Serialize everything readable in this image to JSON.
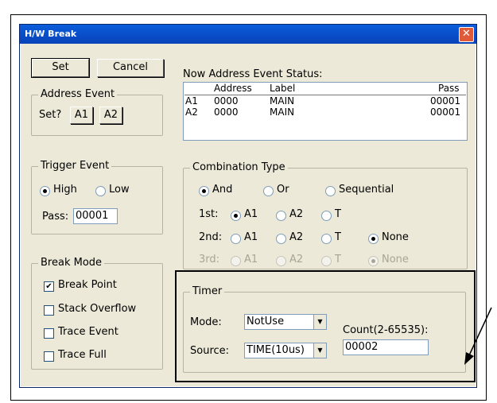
{
  "window": {
    "title": "H/W Break",
    "close_glyph": "✕"
  },
  "buttons": {
    "set": "Set",
    "cancel": "Cancel",
    "a1": "A1",
    "a2": "A2"
  },
  "address_event": {
    "title": "Address Event",
    "set_label": "Set?"
  },
  "status": {
    "label": "Now Address Event Status:",
    "columns": [
      "Address",
      "Label",
      "Pass"
    ],
    "rows": [
      {
        "id": "A1",
        "address": "0000",
        "label": "MAIN",
        "pass": "00001"
      },
      {
        "id": "A2",
        "address": "0000",
        "label": "MAIN",
        "pass": "00001"
      }
    ]
  },
  "trigger": {
    "title": "Trigger Event",
    "high": "High",
    "low": "Low",
    "pass_label": "Pass:",
    "pass_value": "00001",
    "selected": "High"
  },
  "combination": {
    "title": "Combination Type",
    "and": "And",
    "or": "Or",
    "sequential": "Sequential",
    "first_label": "1st:",
    "second_label": "2nd:",
    "third_label": "3rd:",
    "opt_a1": "A1",
    "opt_a2": "A2",
    "opt_t": "T",
    "opt_none": "None"
  },
  "break_mode": {
    "title": "Break Mode",
    "items": [
      {
        "label": "Break Point",
        "checked": true,
        "mark": "✔"
      },
      {
        "label": "Stack Overflow",
        "checked": false,
        "mark": ""
      },
      {
        "label": "Trace Event",
        "checked": false,
        "mark": ""
      },
      {
        "label": "Trace Full",
        "checked": false,
        "mark": ""
      }
    ]
  },
  "timer": {
    "title": "Timer",
    "mode_label": "Mode:",
    "mode_value": "NotUse",
    "source_label": "Source:",
    "source_value": "TIME(10us)",
    "count_label": "Count(2-65535):",
    "count_value": "00002",
    "arrow_glyph": "▼"
  }
}
